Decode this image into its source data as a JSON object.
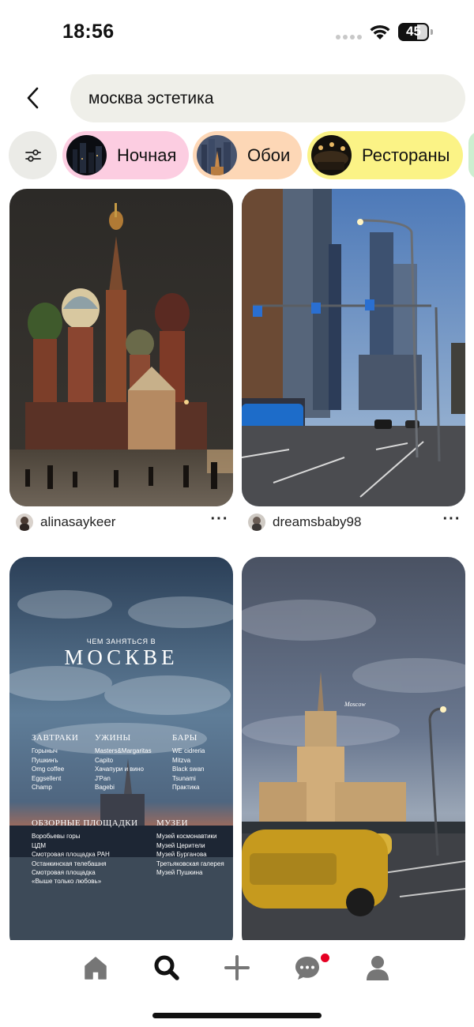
{
  "status_bar": {
    "time": "18:56",
    "battery_level": "45",
    "icons": [
      "signal-dots-icon",
      "wifi-icon",
      "battery-icon"
    ]
  },
  "search": {
    "back_icon": "chevron-left-icon",
    "query": "москва эстетика"
  },
  "filters": {
    "filter_icon": "sliders-icon",
    "chips": [
      {
        "label": "Ночная",
        "color": "#fccde1"
      },
      {
        "label": "Обои",
        "color": "#fdd7b6"
      },
      {
        "label": "Рестораны",
        "color": "#fbf386"
      },
      {
        "label": "",
        "color": "#cdeed0"
      }
    ]
  },
  "pins": [
    {
      "username": "alinasaykeer",
      "subject": "St. Basil's Cathedral at night",
      "more_label": "···"
    },
    {
      "username": "dreamsbaby98",
      "subject": "Moscow City skyscrapers at dusk",
      "more_label": "···"
    },
    {
      "subject": "poster",
      "poster": {
        "subtitle": "ЧЕМ ЗАНЯТЬСЯ В",
        "title": "МОСКВЕ",
        "sections": {
          "breakfast": {
            "header": "ЗАВТРАКИ",
            "items": [
              "Горыныч",
              "Пушкинъ",
              "Omg coffee",
              "Eggsellent",
              "Champ"
            ]
          },
          "dinner": {
            "header": "УЖИНЫ",
            "items": [
              "Masters&Margaritas",
              "Capito",
              "Хачапури и вино",
              "J'Pan",
              "Bagebi"
            ]
          },
          "bars": {
            "header": "БАРЫ",
            "items": [
              "WE cidreria",
              "Mitzva",
              "Black swan",
              "Tsunami",
              "Практика"
            ]
          },
          "views": {
            "header": "ОБЗОРНЫЕ ПЛОЩАДКИ",
            "items": [
              "Воробьевы горы",
              "ЦДМ",
              "Смотровая площадка РАН",
              "Останкинская телебашня",
              "Смотровая площадка",
              "«Выше только любовь»"
            ]
          },
          "museums": {
            "header": "МУЗЕИ",
            "items": [
              "Музей космонавтики",
              "Музей Церители",
              "Музей Бурганова",
              "Третьяковская галерея",
              "Музей Пушкина"
            ]
          }
        }
      }
    },
    {
      "subject": "Hotel Ukraina with taxi",
      "caption": "Moscow"
    }
  ],
  "bottom_nav": {
    "items": [
      {
        "name": "home",
        "icon": "home-icon"
      },
      {
        "name": "search",
        "icon": "search-icon",
        "active": true
      },
      {
        "name": "create",
        "icon": "plus-icon"
      },
      {
        "name": "messages",
        "icon": "chat-bubble-icon",
        "has_notification": true
      },
      {
        "name": "profile",
        "icon": "person-icon"
      }
    ],
    "notification_color": "#e60023"
  }
}
